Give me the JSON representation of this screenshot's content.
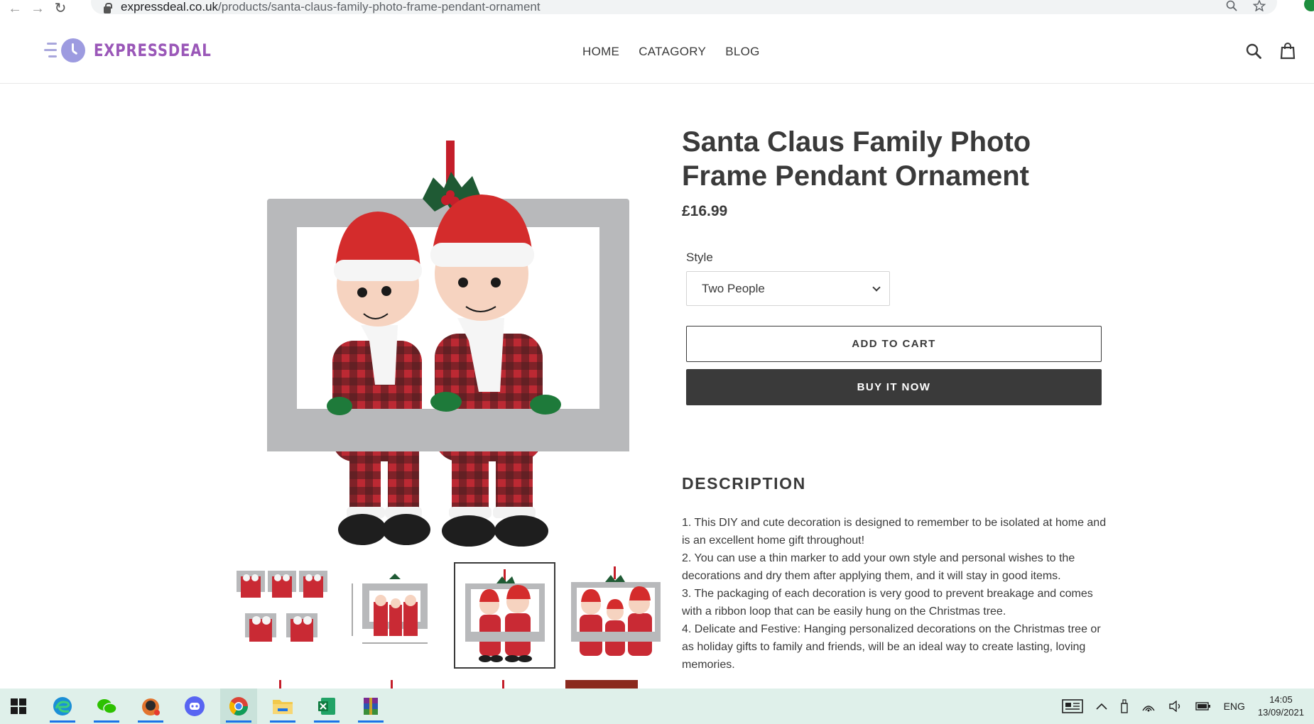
{
  "browser": {
    "url_host": "expressdeal.co.uk",
    "url_path": "/products/santa-claus-family-photo-frame-pendant-ornament"
  },
  "header": {
    "logo_text": "EXPRESSDEAL",
    "nav": [
      {
        "label": "HOME"
      },
      {
        "label": "CATAGORY"
      },
      {
        "label": "BLOG"
      }
    ],
    "icons": [
      "search-icon",
      "cart-icon"
    ]
  },
  "product": {
    "title": "Santa Claus Family Photo Frame Pendant Ornament",
    "price": "£16.99",
    "style_label": "Style",
    "style_selected": "Two People",
    "add_to_cart": "ADD TO CART",
    "buy_now": "BUY IT NOW"
  },
  "description": {
    "heading": "DESCRIPTION",
    "items": [
      "1. This DIY and cute decoration is designed to remember to be isolated at home and is an excellent home gift throughout!",
      "2. You can use a thin marker to add your own style and personal wishes to the decorations and dry them after applying them, and it will stay in good items.",
      "3. The packaging of each decoration is very good to prevent breakage and comes with a ribbon loop that can be easily hung on the Christmas tree.",
      "4. Delicate and Festive: Hanging personalized decorations on the Christmas tree or as holiday gifts to family and friends, will be an ideal way to create lasting, loving memories."
    ]
  },
  "taskbar": {
    "language": "ENG",
    "time": "14:05",
    "date": "13/09/2021",
    "apps": [
      "windows-start-icon",
      "edge-icon",
      "wechat-icon",
      "app-icon",
      "discord-icon",
      "chrome-icon",
      "file-explorer-icon",
      "excel-icon",
      "winrar-icon"
    ]
  },
  "colors": {
    "brand": "#9a57b8",
    "logo_icon": "#9d9be0",
    "text": "#3a3a3a",
    "buy_button": "#3a3a3a",
    "taskbar": "#dff0ea"
  }
}
